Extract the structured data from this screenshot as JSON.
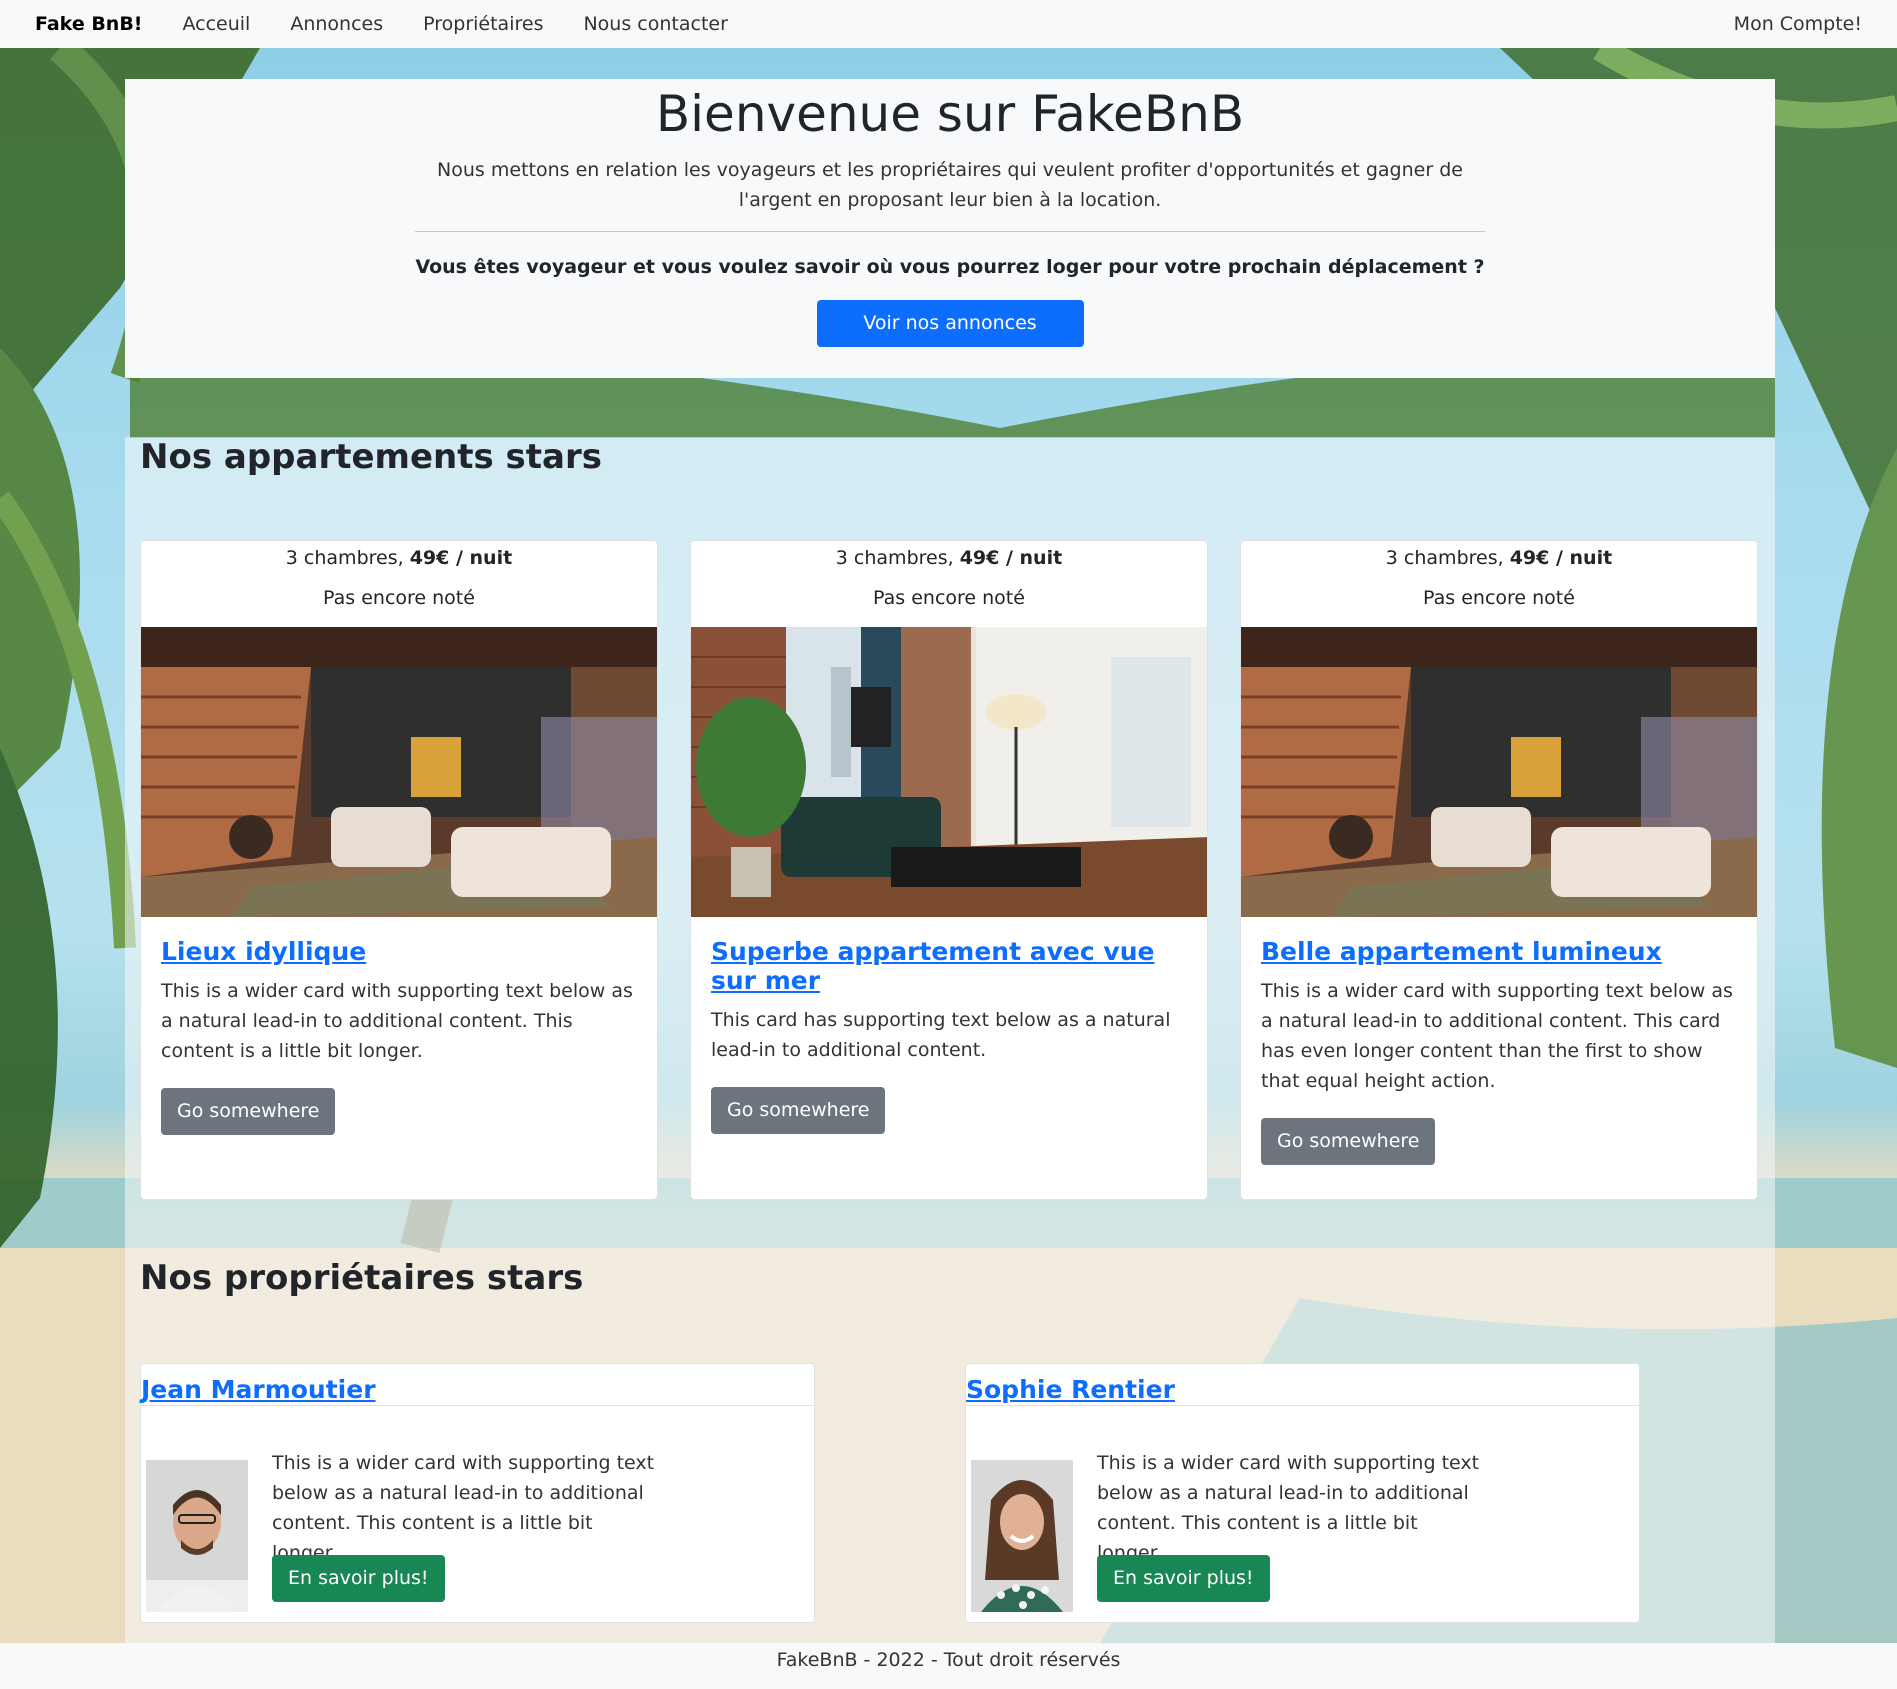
{
  "navbar": {
    "brand": "Fake BnB!",
    "links": [
      "Acceuil",
      "Annonces",
      "Propriétaires",
      "Nous contacter"
    ],
    "account": "Mon Compte!"
  },
  "hero": {
    "title": "Bienvenue sur FakeBnB",
    "lead": "Nous mettons en relation les voyageurs et les propriétaires qui veulent profiter d'opportunités et gagner de l'argent en proposant leur bien à la location.",
    "question": "Vous êtes voyageur et vous voulez savoir où vous pourrez loger pour votre prochain déplacement ?",
    "cta": "Voir nos annonces"
  },
  "apartments": {
    "section_title": "Nos appartements stars",
    "cards": [
      {
        "rooms": "3 chambres,",
        "price": "49€ / nuit",
        "rating": "Pas encore noté",
        "title": "Lieux idyllique",
        "text": "This is a wider card with supporting text below as a natural lead-in to additional content. This content is a little bit longer.",
        "button": "Go somewhere"
      },
      {
        "rooms": "3 chambres,",
        "price": "49€ / nuit",
        "rating": "Pas encore noté",
        "title": "Superbe appartement avec vue sur mer",
        "text": "This card has supporting text below as a natural lead-in to additional content.",
        "button": "Go somewhere"
      },
      {
        "rooms": "3 chambres,",
        "price": "49€ / nuit",
        "rating": "Pas encore noté",
        "title": "Belle appartement lumineux",
        "text": "This is a wider card with supporting text below as a natural lead-in to additional content. This card has even longer content than the first to show that equal height action.",
        "button": "Go somewhere"
      }
    ]
  },
  "owners": {
    "section_title": "Nos propriétaires stars",
    "cards": [
      {
        "name": "Jean Marmoutier",
        "text": "This is a wider card with supporting text below as a natural lead-in to additional content. This content is a little bit longer.",
        "button": "En savoir plus!"
      },
      {
        "name": "Sophie Rentier",
        "text": "This is a wider card with supporting text below as a natural lead-in to additional content. This content is a little bit longer.",
        "button": "En savoir plus!"
      }
    ]
  },
  "footer": {
    "text": "FakeBnB - 2022 - Tout droit réservés"
  },
  "colors": {
    "primary": "#0d6efd",
    "secondary": "#6c757d",
    "success": "#198754",
    "light": "#f8f9fa"
  }
}
